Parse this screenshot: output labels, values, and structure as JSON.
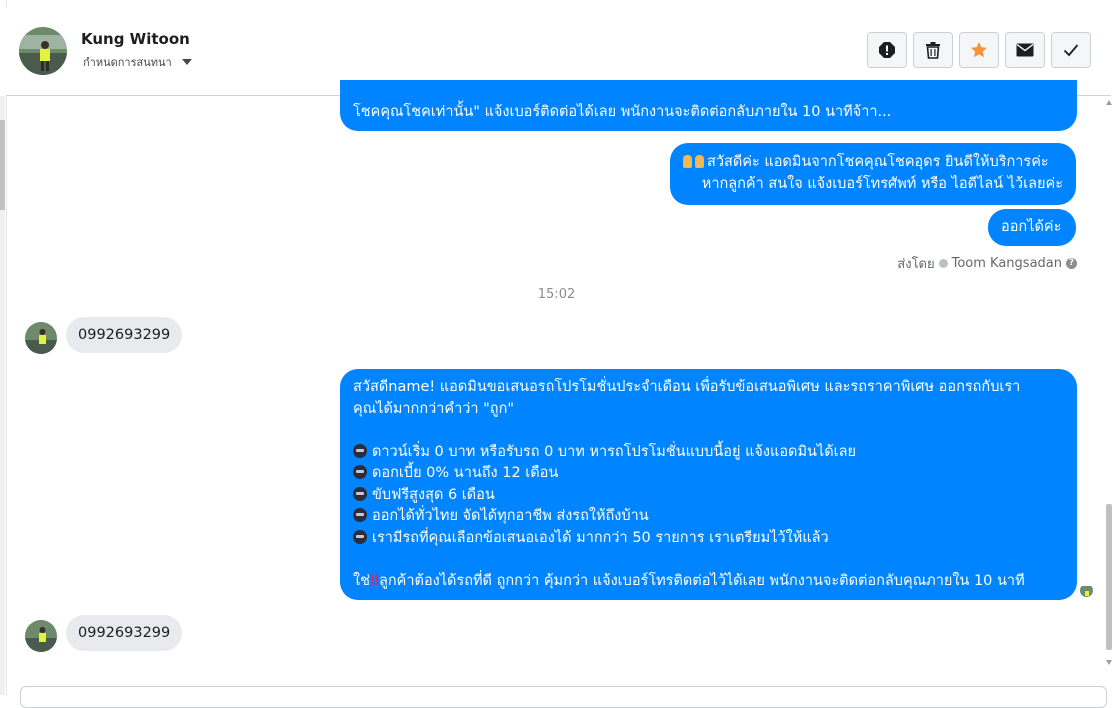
{
  "header": {
    "contact_name": "Kung Witoon",
    "assign_label": "กำหนดการสนทนา",
    "actions": [
      {
        "name": "spam",
        "icon": "exclamation-icon"
      },
      {
        "name": "delete",
        "icon": "trash-icon"
      },
      {
        "name": "star",
        "icon": "star-icon"
      },
      {
        "name": "unread",
        "icon": "envelope-icon"
      },
      {
        "name": "done",
        "icon": "check-icon"
      }
    ]
  },
  "messages": {
    "m1_line1": "โชคคุณโชคเท่านั้น\" แจ้งเบอร์ติดต่อได้เลย พนักงานจะติดต่อกลับภายใน 10 นาทีจ้าา...",
    "m2_line1": "สวัสดีค่ะ แอดมินจากโชคคุณโชคอุดร ยินดีให้บริการค่ะ",
    "m2_line2": "หากลูกค้า สนใจ แจ้งเบอร์โทรศัพท์ หรือ ไอดีไลน์  ไว้เลยค่ะ",
    "m3": "ออกได้ค่ะ",
    "sent_by_prefix": "ส่งโดย",
    "sent_by_name": "Toom Kangsadan",
    "timestamp": "15:02",
    "in1": "0992693299",
    "promo": {
      "l1": "สวัสดีname! แอดมินขอเสนอรถโปรโมชั่นประจำเดือน เพื่อรับข้อเสนอพิเศษ และรถราคาพิเศษ ออกรถกับเรา",
      "l2": "คุณได้มากกว่าคำว่า \"ถูก\"",
      "b1": "ดาวน์เริ่ม 0 บาท หรือรับรถ 0 บาท หารถโปรโมชั่นแบบนี้อยู่ แจ้งแอดมินได้เลย",
      "b2": "ดอกเบี้ย 0% นานถึง 12 เดือน",
      "b3": "ขับฟรีสูงสุด 6 เดือน",
      "b4": "ออกได้ทั่วไทย จัดได้ทุกอาชีพ ส่งรถให้ถึงบ้าน",
      "b5": "เรามีรถที่คุณเลือกข้อเสนอเองได้ มากกว่า 50 รายการ เราเตรียมไว้ให้แล้ว",
      "l_end_a": "ใช่",
      "l_end_b": "‼",
      "l_end_c": "ลูกค้าต้องได้รถที่ดี ถูกกว่า คุ้มกว่า แจ้งเบอร์โทรติดต่อไว้ได้เลย พนักงานจะติดต่อกลับคุณภายใน 10 นาที"
    },
    "in2": "0992693299"
  },
  "colors": {
    "outgoing": "#0084ff",
    "incoming": "#e9eaed",
    "star": "#f7923a"
  }
}
